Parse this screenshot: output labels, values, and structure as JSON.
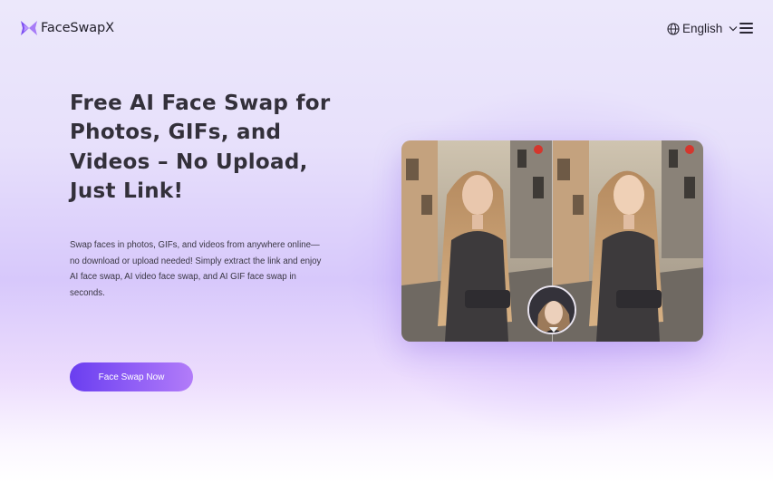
{
  "brand": {
    "name": "FaceSwapX"
  },
  "header": {
    "language": "English"
  },
  "hero": {
    "title": "Free AI Face Swap for Photos, GIFs, and Videos – No Upload, Just Link!",
    "description": "Swap faces in photos, GIFs, and videos from anywhere online—no download or upload needed! Simply extract the link and enjoy AI face swap, AI video face swap, and AI GIF face swap in seconds.",
    "cta_label": "Face Swap Now"
  },
  "colors": {
    "accent_start": "#6a3ef0",
    "accent_end": "#b27cf9",
    "text_dark": "#33303a"
  },
  "icons": [
    "butterfly-logo-icon",
    "globe-icon",
    "chevron-down-icon",
    "hamburger-menu-icon",
    "recording-indicator-icon"
  ]
}
